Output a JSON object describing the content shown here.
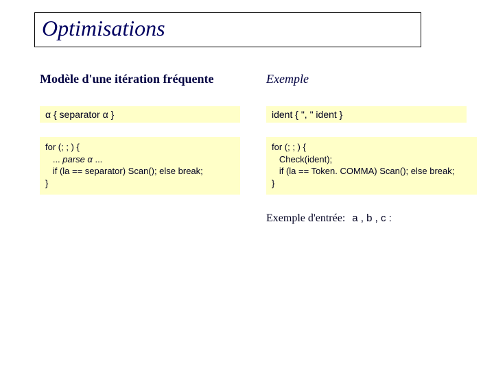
{
  "title": "Optimisations",
  "left": {
    "heading": "Modèle d'une itération fréquente",
    "grammar_prefix": "α { separator α }",
    "code_l1": "for (; ; ) {",
    "code_l2_a": "   ... ",
    "code_l2_em": "parse α",
    "code_l2_b": " ...",
    "code_l3": "   if (la == separator) Scan(); else break;",
    "code_l4": "}"
  },
  "right": {
    "heading": "Exemple",
    "grammar": "ident { \", \" ident }",
    "code_l1": "for (; ; ) {",
    "code_l2": "   Check(ident);",
    "code_l3": "   if (la == Token. COMMA) Scan(); else break;",
    "code_l4": "}"
  },
  "sample": {
    "label": "Exemple d'entrée:",
    "value": "a , b , c :"
  }
}
